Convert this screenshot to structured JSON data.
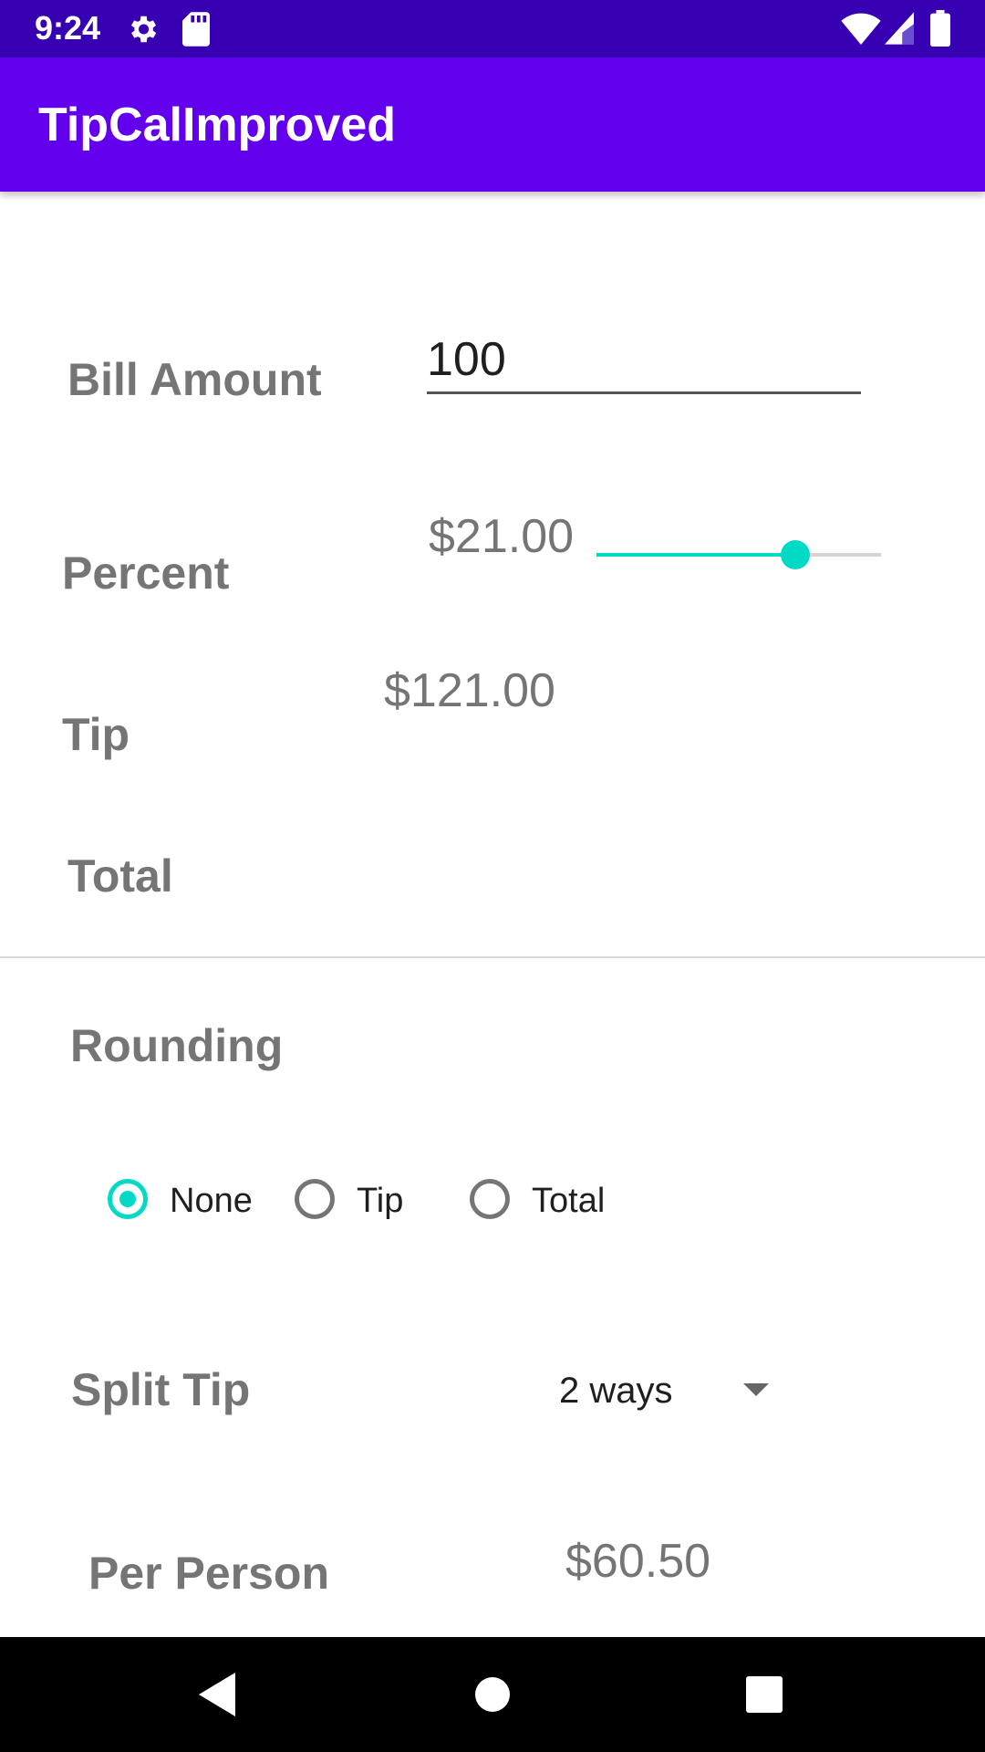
{
  "status_bar": {
    "time": "9:24",
    "left_icons": [
      "gear-icon",
      "sd-card-icon"
    ],
    "right_icons": [
      "wifi-icon",
      "cell-signal-icon",
      "battery-icon"
    ]
  },
  "app_bar": {
    "title": "TipCalImproved",
    "color": "#6200ee"
  },
  "form": {
    "bill_amount": {
      "label": "Bill Amount",
      "value": "100"
    },
    "percent": {
      "label": "Percent",
      "value": "$21.00",
      "slider_fraction": 0.7
    },
    "tip": {
      "label": "Tip",
      "value": "$121.00"
    },
    "total": {
      "label": "Total"
    }
  },
  "rounding": {
    "label": "Rounding",
    "options": [
      {
        "label": "None",
        "checked": true
      },
      {
        "label": "Tip",
        "checked": false
      },
      {
        "label": "Total",
        "checked": false
      }
    ]
  },
  "split_tip": {
    "label": "Split Tip",
    "selected": "2 ways"
  },
  "per_person": {
    "label": "Per Person",
    "value": "$60.50"
  },
  "nav_bar": {
    "buttons": [
      "back-icon",
      "home-icon",
      "recents-icon"
    ]
  },
  "colors": {
    "status_bar": "#3700b3",
    "accent": "#03dac5",
    "label_text": "#757575"
  }
}
